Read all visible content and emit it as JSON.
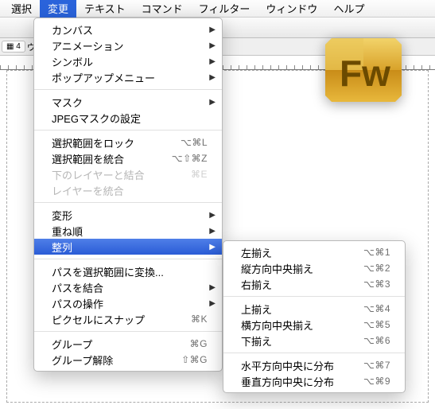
{
  "menubar": {
    "items": [
      {
        "label": "選択",
        "active": false
      },
      {
        "label": "変更",
        "active": true
      },
      {
        "label": "テキスト",
        "active": false
      },
      {
        "label": "コマンド",
        "active": false
      },
      {
        "label": "フィルター",
        "active": false
      },
      {
        "label": "ウィンドウ",
        "active": false
      },
      {
        "label": "ヘルプ",
        "active": false
      }
    ]
  },
  "substrip": {
    "page_count": "4",
    "page_unit_label": "ウィ"
  },
  "logo": {
    "text": "Fw"
  },
  "main_menu": {
    "groups": [
      [
        {
          "label": "カンバス",
          "submenu": true
        },
        {
          "label": "アニメーション",
          "submenu": true
        },
        {
          "label": "シンボル",
          "submenu": true
        },
        {
          "label": "ポップアップメニュー",
          "submenu": true
        }
      ],
      [
        {
          "label": "マスク",
          "submenu": true
        },
        {
          "label": "JPEGマスクの設定"
        }
      ],
      [
        {
          "label": "選択範囲をロック",
          "shortcut": "⌥⌘L"
        },
        {
          "label": "選択範囲を統合",
          "shortcut": "⌥⇧⌘Z"
        },
        {
          "label": "下のレイヤーと結合",
          "shortcut": "⌘E",
          "disabled": true
        },
        {
          "label": "レイヤーを統合",
          "disabled": true
        }
      ],
      [
        {
          "label": "変形",
          "submenu": true
        },
        {
          "label": "重ね順",
          "submenu": true
        },
        {
          "label": "整列",
          "submenu": true,
          "highlight": true
        }
      ],
      [
        {
          "label": "パスを選択範囲に変換..."
        },
        {
          "label": "パスを結合",
          "submenu": true
        },
        {
          "label": "パスの操作",
          "submenu": true
        },
        {
          "label": "ピクセルにスナップ",
          "shortcut": "⌘K"
        }
      ],
      [
        {
          "label": "グループ",
          "shortcut": "⌘G"
        },
        {
          "label": "グループ解除",
          "shortcut": "⇧⌘G"
        }
      ]
    ]
  },
  "sub_menu": {
    "groups": [
      [
        {
          "label": "左揃え",
          "shortcut": "⌥⌘1"
        },
        {
          "label": "縦方向中央揃え",
          "shortcut": "⌥⌘2"
        },
        {
          "label": "右揃え",
          "shortcut": "⌥⌘3"
        }
      ],
      [
        {
          "label": "上揃え",
          "shortcut": "⌥⌘4"
        },
        {
          "label": "横方向中央揃え",
          "shortcut": "⌥⌘5"
        },
        {
          "label": "下揃え",
          "shortcut": "⌥⌘6"
        }
      ],
      [
        {
          "label": "水平方向中央に分布",
          "shortcut": "⌥⌘7"
        },
        {
          "label": "垂直方向中央に分布",
          "shortcut": "⌥⌘9"
        }
      ]
    ]
  }
}
